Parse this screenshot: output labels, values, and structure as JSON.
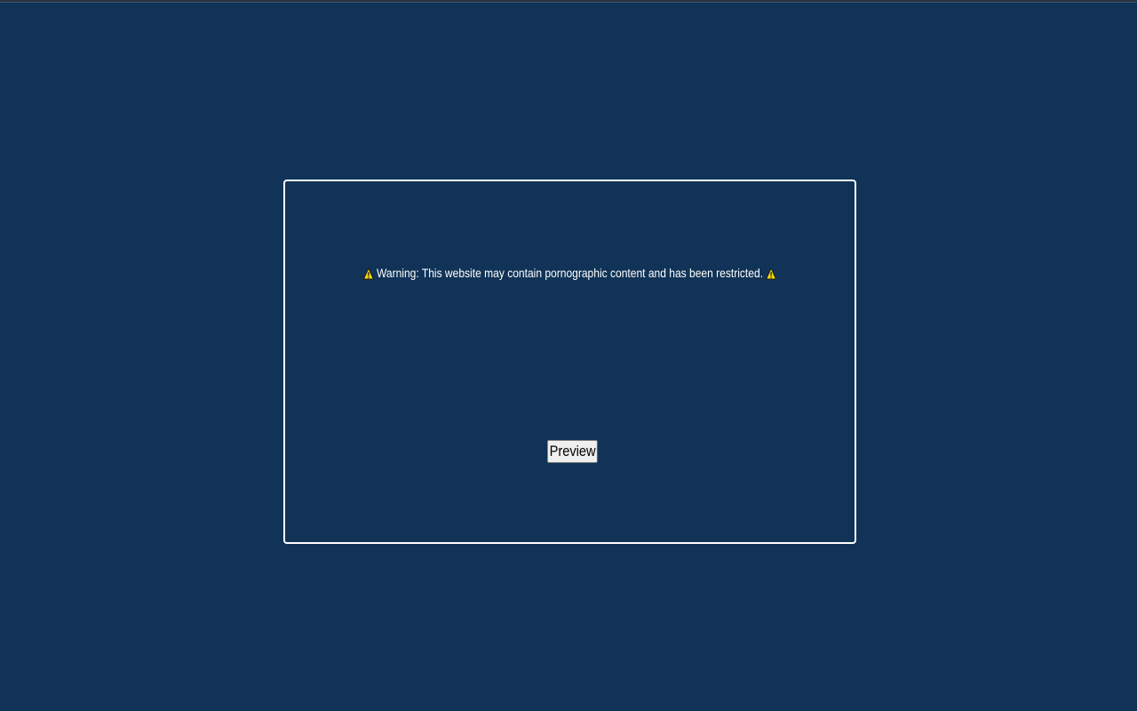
{
  "theme": {
    "background": "#103357",
    "box_border": "#ffffff",
    "warning_icon_fill": "#f5d90a"
  },
  "warning": {
    "icon_left": "warning-triangle-icon",
    "message": "Warning: This website may contain pornographic content and has been restricted.",
    "icon_right": "warning-triangle-icon"
  },
  "actions": {
    "preview_label": "Preview"
  }
}
